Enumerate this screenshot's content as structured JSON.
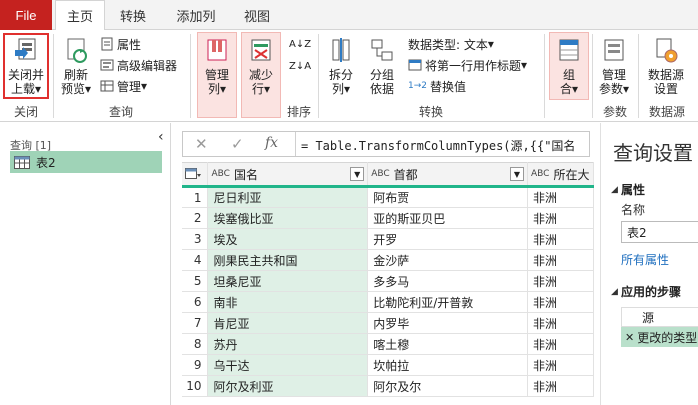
{
  "tabs": {
    "file": "File",
    "items": [
      {
        "label": "主页",
        "active": true
      },
      {
        "label": "转换",
        "active": false
      },
      {
        "label": "添加列",
        "active": false
      },
      {
        "label": "视图",
        "active": false
      }
    ]
  },
  "ribbon": {
    "close_load": {
      "line1": "关闭并",
      "line2": "上载",
      "arrow": "▾"
    },
    "refresh": {
      "line1": "刷新",
      "line2": "预览",
      "arrow": "▾"
    },
    "properties": "属性",
    "advanced_editor": "高级编辑器",
    "manage": "管理",
    "manage_arrow": "▾",
    "manage_cols": {
      "line1": "管理",
      "line2": "列",
      "arrow": "▾"
    },
    "reduce_rows": {
      "line1": "减少",
      "line2": "行",
      "arrow": "▾"
    },
    "split_col": {
      "line1": "拆分",
      "line2": "列",
      "arrow": "▾"
    },
    "group_by": {
      "line1": "分组",
      "line2": "依据"
    },
    "data_type": "数据类型: 文本",
    "data_type_arrow": "▾",
    "first_row_header": "将第一行用作标题",
    "first_row_arrow": "▾",
    "replace_values": "替换值",
    "combine": {
      "line1": "组",
      "line2": "合",
      "arrow": "▾"
    },
    "manage_params": {
      "line1": "管理",
      "line2": "参数",
      "arrow": "▾"
    },
    "ds_settings": {
      "line1": "数据源",
      "line2": "设置"
    },
    "groups": {
      "close": "关闭",
      "query": "查询",
      "sort": "排序",
      "transform": "转换",
      "params": "参数",
      "datasource": "数据源"
    },
    "sort_asc": "A↓Z",
    "sort_desc": "Z↓A",
    "replace_glyph": "1→2"
  },
  "queries": {
    "header": "查询 [1]",
    "collapse": "‹",
    "items": [
      "表2"
    ]
  },
  "formula": {
    "cancel": "✕",
    "confirm": "✓",
    "fx": "fx",
    "text": "= Table.TransformColumnTypes(源,{{\"国名"
  },
  "grid": {
    "type_glyph": "ABC",
    "columns": [
      "国名",
      "首都",
      "所在大"
    ],
    "rows": [
      [
        "1",
        "尼日利亚",
        "阿布贾",
        "非洲"
      ],
      [
        "2",
        "埃塞俄比亚",
        "亚的斯亚贝巴",
        "非洲"
      ],
      [
        "3",
        "埃及",
        "开罗",
        "非洲"
      ],
      [
        "4",
        "刚果民主共和国",
        "金沙萨",
        "非洲"
      ],
      [
        "5",
        "坦桑尼亚",
        "多多马",
        "非洲"
      ],
      [
        "6",
        "南非",
        "比勒陀利亚/开普敦",
        "非洲"
      ],
      [
        "7",
        "肯尼亚",
        "内罗毕",
        "非洲"
      ],
      [
        "8",
        "苏丹",
        "喀土穆",
        "非洲"
      ],
      [
        "9",
        "乌干达",
        "坎帕拉",
        "非洲"
      ],
      [
        "10",
        "阿尔及利亚",
        "阿尔及尔",
        "非洲"
      ]
    ]
  },
  "settings": {
    "title": "查询设置",
    "props_header": "属性",
    "name_label": "名称",
    "name_value": "表2",
    "all_props": "所有属性",
    "steps_header": "应用的步骤",
    "steps": [
      "源",
      "更改的类型"
    ],
    "delete_glyph": "✕",
    "triangle": "◢"
  },
  "colors": {
    "file_tab": "#c5221f",
    "accent_green": "#21b58a",
    "selected_query": "#9fd3b7",
    "highlight_red": "#e0302e"
  }
}
